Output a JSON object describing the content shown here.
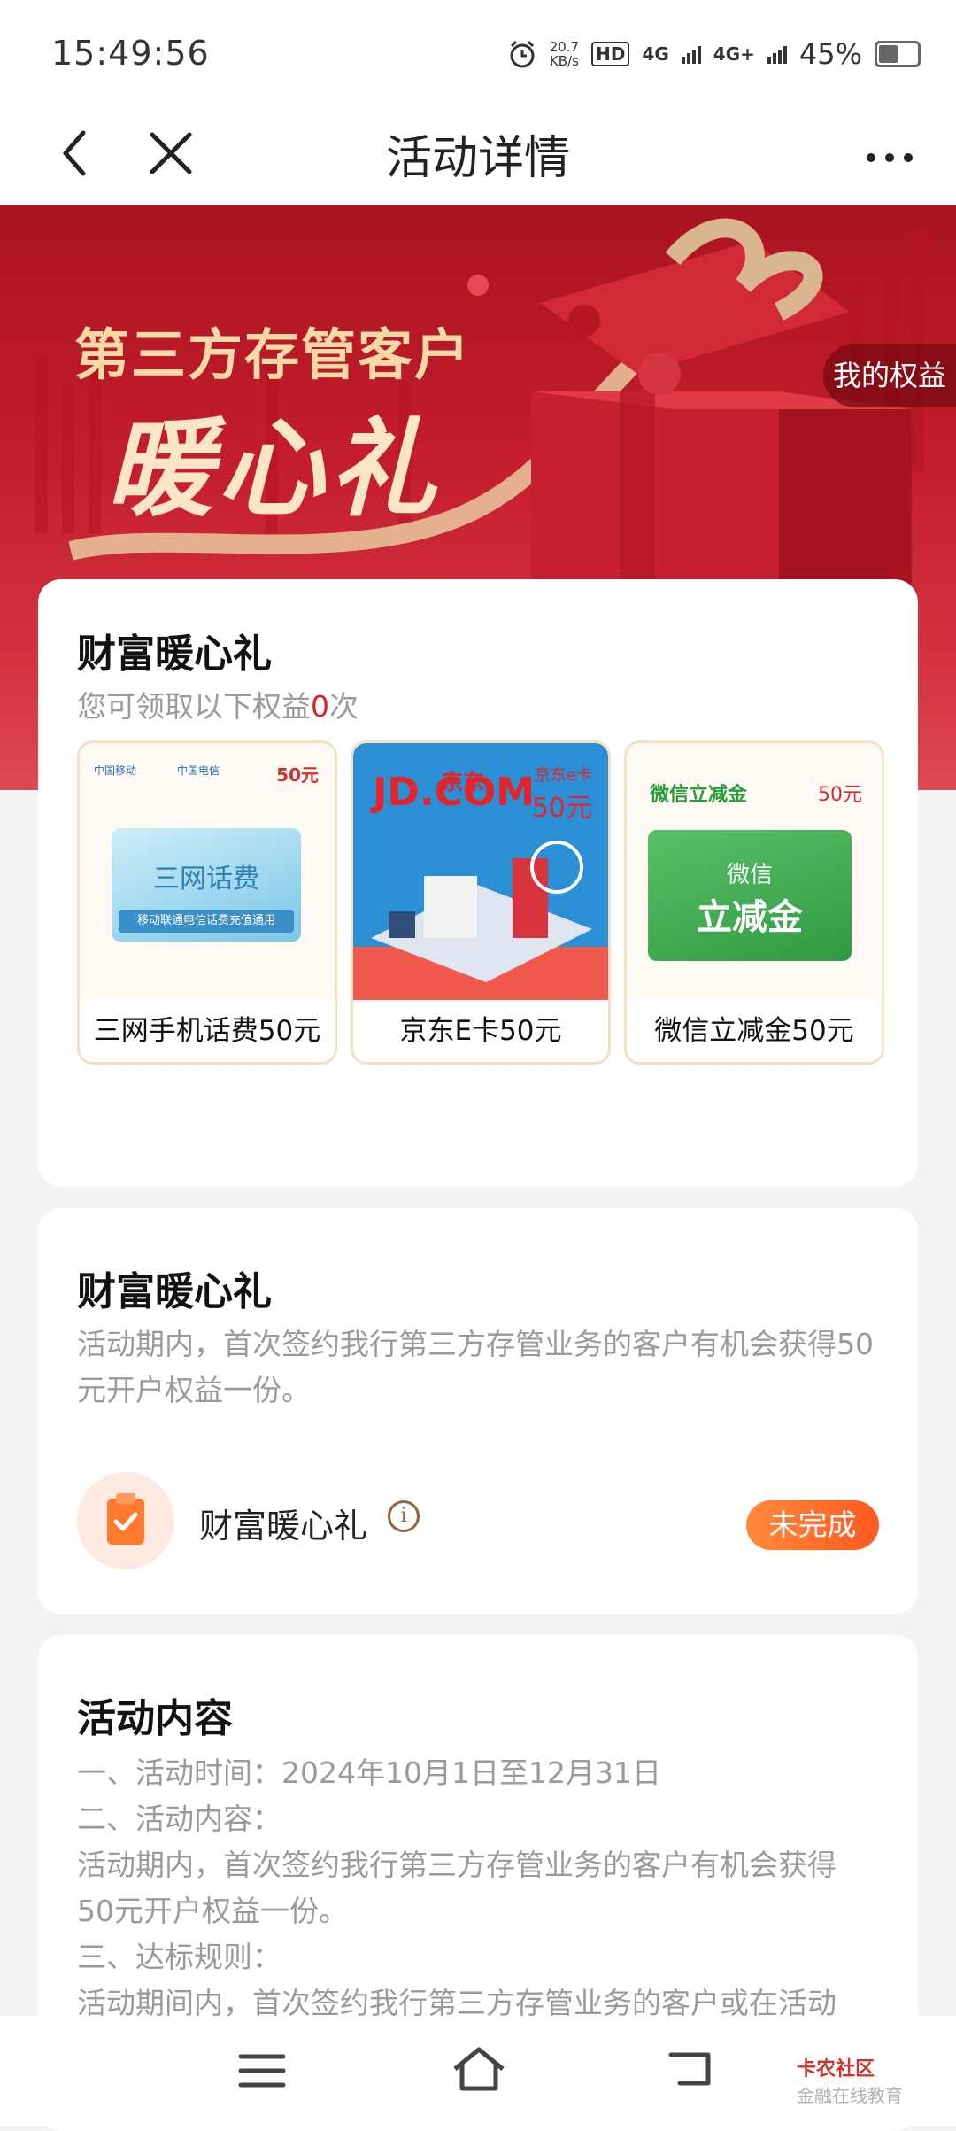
{
  "status_bar": {
    "time": "15:49:56",
    "net_speed_value": "20.7",
    "net_speed_unit": "KB/s",
    "hd": "HD",
    "sim1": "4G",
    "sim2": "4G+",
    "battery_text": "45%",
    "battery_level": 0.45
  },
  "nav": {
    "title": "活动详情"
  },
  "banner": {
    "title": "第三方存管客户",
    "subtitle": "暖心礼",
    "my_rights": "我的权益"
  },
  "card1": {
    "heading": "财富暖心礼",
    "sub_prefix": "您可领取以下权益",
    "count": "0",
    "sub_suffix": "次",
    "gifts": [
      {
        "label": "三网手机话费50元",
        "img_amount": "50元",
        "img_title": "三网话费",
        "img_desc": "移动联通电信话费充值通用",
        "brand1": "中国移动",
        "brand2": "中国电信"
      },
      {
        "label": "京东E卡50元",
        "img_brand": "JD.COM",
        "img_brand_cn": "京东",
        "img_card": "京东e卡",
        "img_amount": "50元"
      },
      {
        "label": "微信立减金50元",
        "img_top": "微信立减金",
        "img_amount": "50元",
        "img_line1": "微信",
        "img_line2": "立减金"
      }
    ]
  },
  "card2": {
    "heading": "财富暖心礼",
    "desc": "活动期内，首次签约我行第三方存管业务的客户有机会获得50元开户权益一份。",
    "task_name": "财富暖心礼",
    "task_status": "未完成"
  },
  "card3": {
    "heading": "活动内容",
    "lines": [
      "一、活动时间：2024年10月1日至12月31日",
      "二、活动内容：",
      "活动期内，首次签约我行第三方存管业务的客户有机会获得",
      "50元开户权益一份。",
      "三、达标规则：",
      "活动期间内，首次签约我行第三方存管业务的客户或在活动"
    ]
  },
  "watermark": {
    "name": "卡农社区",
    "slogan": "金融在线教育"
  },
  "colors": {
    "accent": "#ff6a26",
    "banner_red": "#c41e2c",
    "highlight_red": "#e02020"
  }
}
